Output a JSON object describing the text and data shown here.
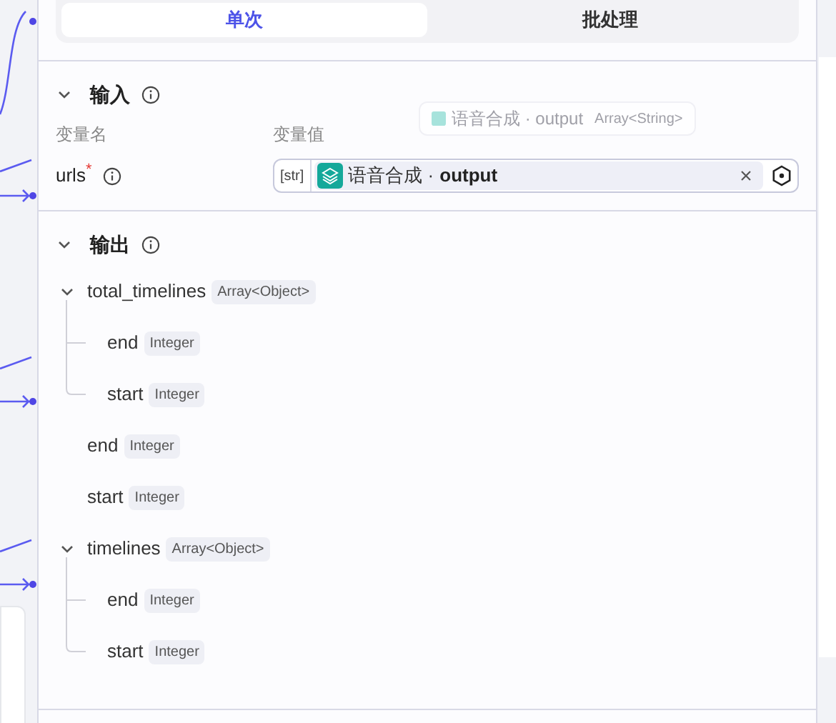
{
  "tabs": [
    {
      "label": "单次",
      "selected": true
    },
    {
      "label": "批处理",
      "selected": false
    }
  ],
  "input": {
    "title": "输入",
    "expanded": true,
    "columns": [
      "变量名",
      "变量值"
    ],
    "drag_preview": {
      "node": "语音合成",
      "separator": "·",
      "field": "output",
      "type": "Array<String>"
    },
    "params": [
      {
        "name": "urls",
        "required_mark": "*",
        "type_tag": "[str]",
        "node": "语音合成",
        "separator": "·",
        "field": "output"
      }
    ]
  },
  "output": {
    "title": "输出",
    "expanded": true,
    "fields": [
      {
        "name": "total_timelines",
        "type": "Array<Object>",
        "expanded": true,
        "children": [
          {
            "name": "end",
            "type": "Integer"
          },
          {
            "name": "start",
            "type": "Integer"
          }
        ]
      },
      {
        "name": "end",
        "type": "Integer"
      },
      {
        "name": "start",
        "type": "Integer"
      },
      {
        "name": "timelines",
        "type": "Array<Object>",
        "expanded": true,
        "children": [
          {
            "name": "end",
            "type": "Integer"
          },
          {
            "name": "start",
            "type": "Integer"
          }
        ]
      }
    ]
  }
}
